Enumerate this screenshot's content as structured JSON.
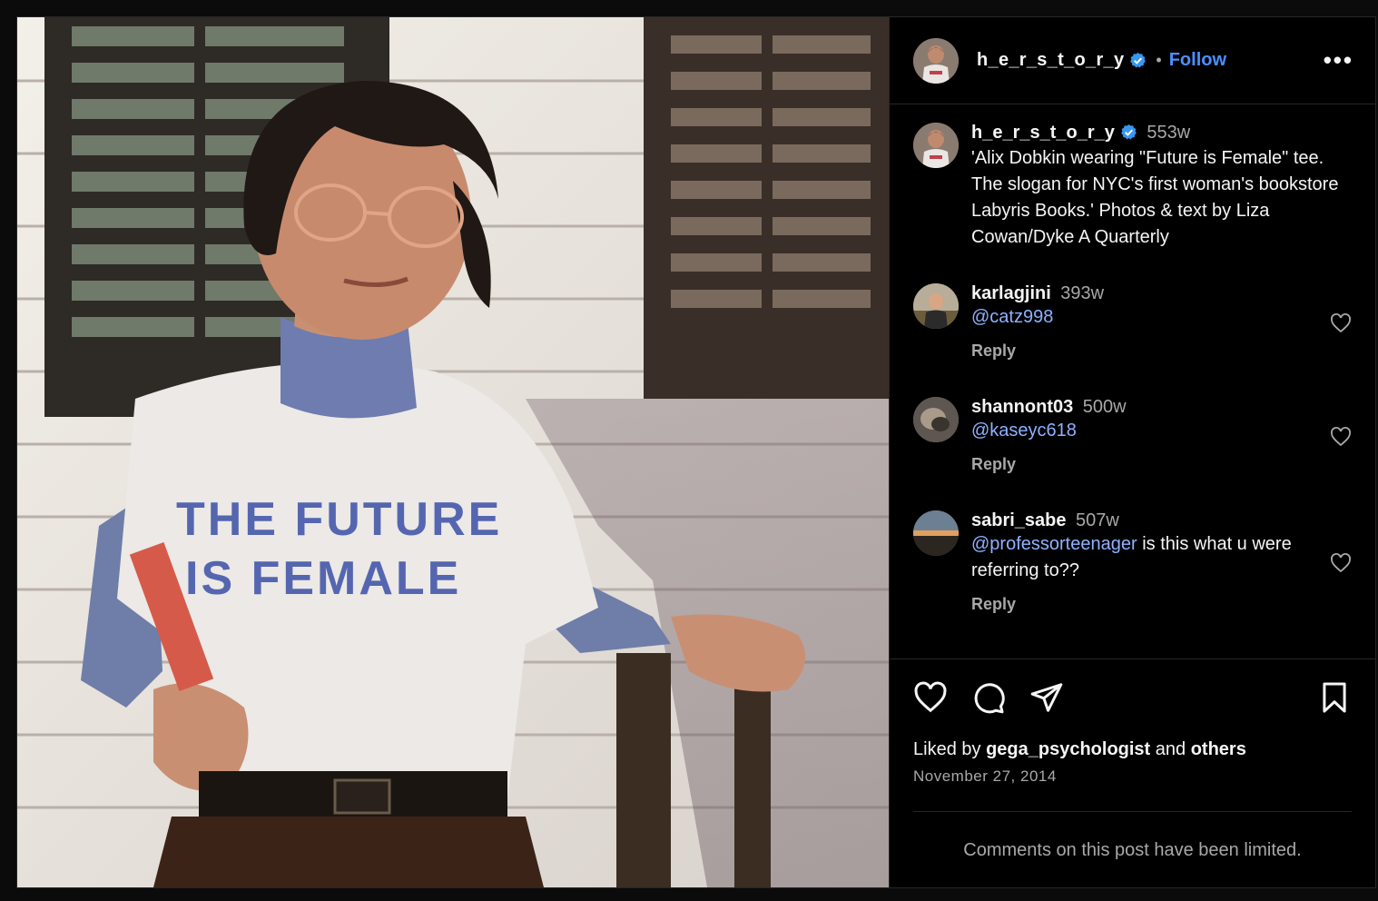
{
  "post": {
    "author": "h_e_r_s_t_o_r_y",
    "separator": "•",
    "follow_label": "Follow",
    "more_label": "•••"
  },
  "photo": {
    "shirt_text_line1": "THE FUTURE",
    "shirt_text_line2": "IS FEMALE"
  },
  "caption": {
    "username": "h_e_r_s_t_o_r_y",
    "time": "553w",
    "text": "'Alix Dobkin wearing \"Future is Female\" tee. The slogan for NYC's first woman's bookstore Labyris Books.' Photos & text by Liza Cowan/Dyke A Quarterly"
  },
  "comments": [
    {
      "username": "karlagjini",
      "time": "393w",
      "mention": "@catz998",
      "text": "",
      "reply": "Reply"
    },
    {
      "username": "shannont03",
      "time": "500w",
      "mention": "@kaseyc618",
      "text": "",
      "reply": "Reply"
    },
    {
      "username": "sabri_sabe",
      "time": "507w",
      "mention": "@professorteenager",
      "text": " is this what u were referring to??",
      "reply": "Reply"
    }
  ],
  "engagement": {
    "liked_prefix": "Liked by ",
    "liked_user": "gega_psychologist",
    "liked_mid": " and ",
    "liked_others": "others",
    "date": "November 27, 2014"
  },
  "footer": {
    "limited_text": "Comments on this post have been limited."
  },
  "colors": {
    "accent": "#4a90ff",
    "mention": "#8fb1ff",
    "verified": "#3897f0"
  },
  "icons": {
    "like": "heart-icon",
    "comment": "comment-bubble-icon",
    "share": "paper-plane-icon",
    "save": "bookmark-icon",
    "verified": "verified-badge-icon",
    "more": "more-options-icon"
  }
}
